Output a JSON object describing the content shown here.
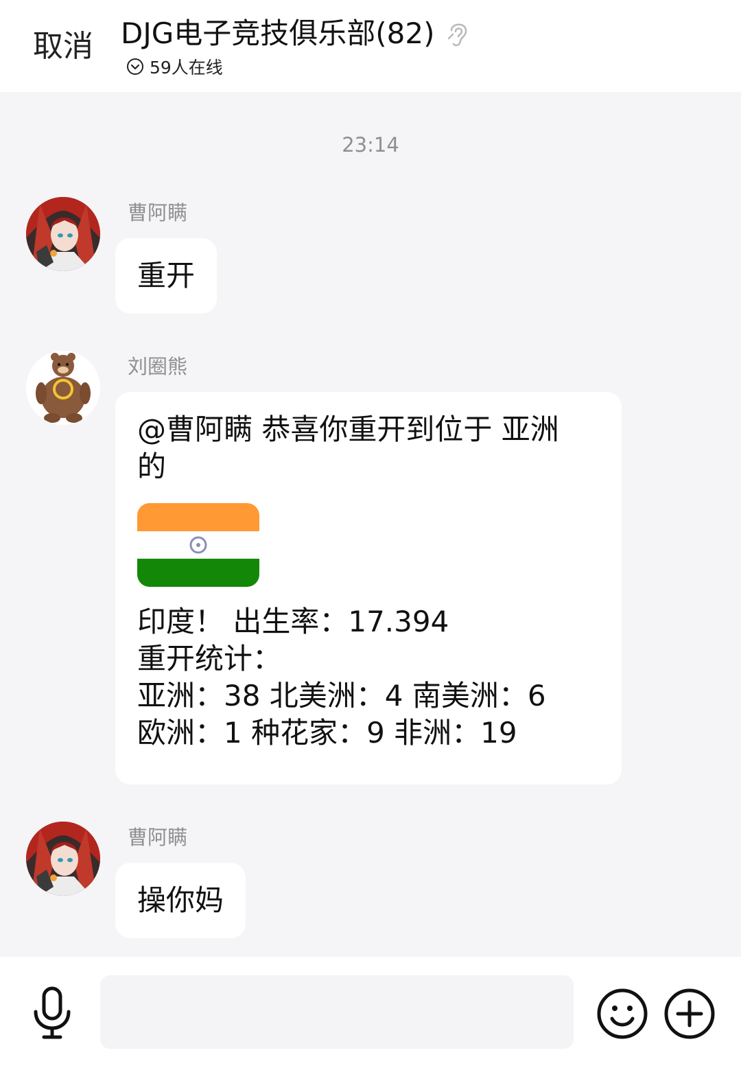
{
  "header": {
    "cancel_label": "取消",
    "title": "DJG电子竞技俱乐部(82)",
    "online_text": "59人在线"
  },
  "chat": {
    "timestamp": "23:14",
    "messages": [
      {
        "sender": "曹阿瞒",
        "text": "重开"
      },
      {
        "sender": "刘圈熊",
        "line1": "@曹阿瞒 恭喜你重开到位于 亚洲",
        "line2": "的",
        "flag_colors": [
          "#ff9933",
          "#ffffff",
          "#138808"
        ],
        "result_line": "印度！ 出生率：17.394",
        "stats_title": "重开统计：",
        "stats_line1": "亚洲：38 北美洲：4 南美洲：6",
        "stats_line2": "欧洲：1 种花家：9 非洲：19"
      },
      {
        "sender": "曹阿瞒",
        "text": "操你妈"
      }
    ]
  },
  "input": {
    "value": "",
    "placeholder": ""
  }
}
